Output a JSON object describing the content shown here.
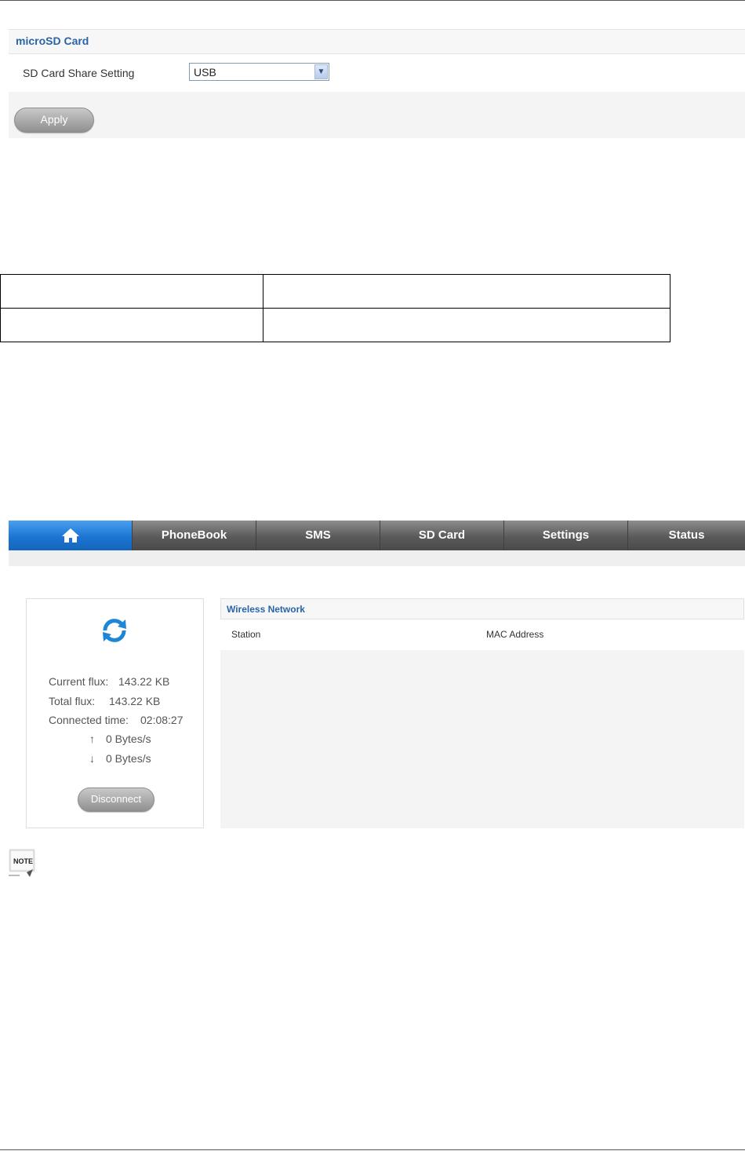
{
  "microsd": {
    "title": "microSD Card",
    "share_label": "SD Card Share Setting",
    "share_value": "USB",
    "apply_label": "Apply"
  },
  "nav": {
    "items": [
      "PhoneBook",
      "SMS",
      "SD Card",
      "Settings",
      "Status"
    ]
  },
  "status": {
    "current_flux_label": "Current flux:",
    "current_flux_value": "143.22 KB",
    "total_flux_label": "Total flux:",
    "total_flux_value": "143.22 KB",
    "connected_time_label": "Connected time:",
    "connected_time_value": "02:08:27",
    "upload_rate": "0 Bytes/s",
    "download_rate": "0 Bytes/s",
    "disconnect_label": "Disconnect"
  },
  "wireless": {
    "title": "Wireless Network",
    "col_station": "Station",
    "col_mac": "MAC Address"
  },
  "note_label": "NOTE",
  "icons": {
    "home": "home-icon",
    "refresh": "refresh-icon",
    "upload": "arrow-up-icon",
    "download": "arrow-down-icon",
    "select": "chevron-down-icon",
    "note": "note-icon"
  },
  "colors": {
    "accent_blue": "#1b75d2",
    "title_blue": "#2a64a8",
    "nav_gray": "#5a5a5a"
  }
}
